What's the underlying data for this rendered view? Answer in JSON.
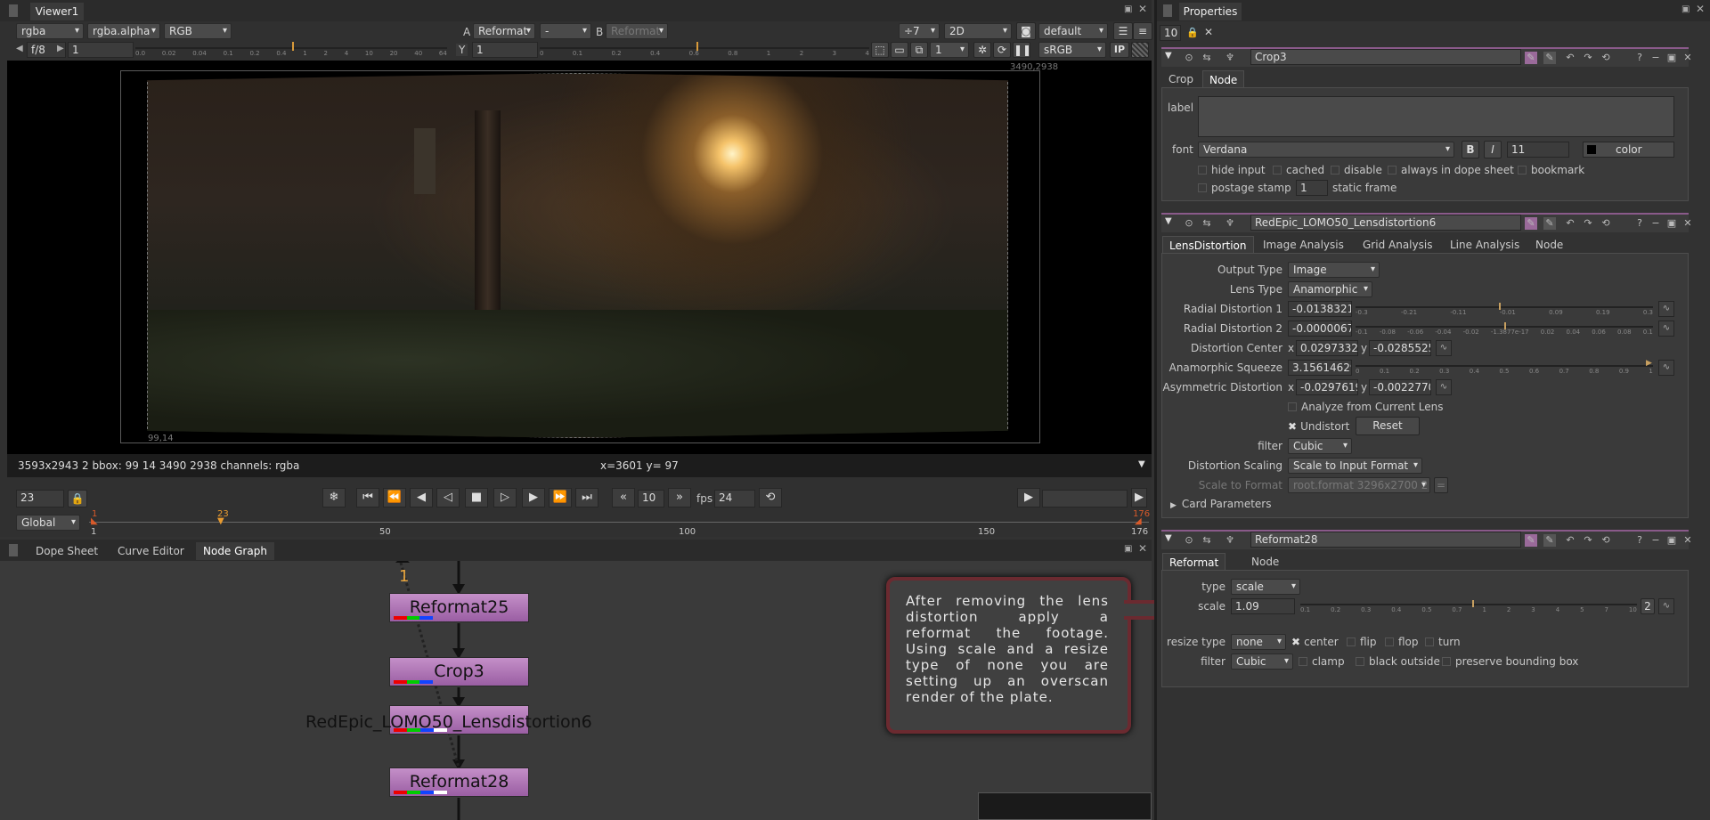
{
  "viewer": {
    "tab": "Viewer1",
    "channels": "rgba",
    "alpha": "rgba.alpha",
    "colorspace": "RGB",
    "a_label": "A",
    "a_input": "Reformat",
    "a_op": "-",
    "b_label": "B",
    "b_input": "Reformat",
    "proxy": "÷7",
    "view_mode": "2D",
    "lut": "default",
    "lut2": "sRGB",
    "fstop": "f/8",
    "gain": "1",
    "y_label": "Y",
    "gamma": "1",
    "frame_sel": "1",
    "ip": "IP",
    "gain_ticks": [
      "0.0",
      "0.02",
      "0.04",
      "0.1",
      "0.2",
      "0.4",
      "1",
      "2",
      "4",
      "10",
      "20",
      "40",
      "64"
    ],
    "gamma_ticks": [
      "0",
      "0.1",
      "0.2",
      "0.4",
      "0.6",
      "0.8",
      "1",
      "2",
      "3",
      "4"
    ],
    "corner_tr": "3490,2938",
    "corner_bl": "99,14",
    "info": "3593x2943 2 bbox: 99 14 3490 2938 channels: rgba",
    "cursor": "x=3601 y=  97"
  },
  "timeline": {
    "frame": "23",
    "fps_label": "fps",
    "fps": "24",
    "step": "10",
    "range": "Global",
    "start": "1",
    "end": "176",
    "current": "23",
    "labels": [
      "1",
      "50",
      "100",
      "150",
      "176"
    ]
  },
  "graph": {
    "tabs": [
      "Dope Sheet",
      "Curve Editor",
      "Node Graph"
    ],
    "marker": "1",
    "nodes": [
      "Reformat25",
      "Crop3",
      "RedEpic_LOMO50_Lensdistortion6",
      "Reformat28"
    ],
    "note": "After removing the lens distortion apply a reformat the footage. Using scale and a resize type of none you are setting up an overscan render of the plate."
  },
  "properties": {
    "title": "Properties",
    "max_panels": "10",
    "crop": {
      "name": "Crop3",
      "tabs": [
        "Crop",
        "Node"
      ],
      "label_lbl": "label",
      "font_lbl": "font",
      "font": "Verdana",
      "bold": "B",
      "italic": "I",
      "size": "11",
      "color_lbl": "color",
      "checks": [
        "hide input",
        "cached",
        "disable",
        "always in dope sheet",
        "bookmark"
      ],
      "postage": "postage stamp",
      "postage_val": "1",
      "static": "static frame"
    },
    "lens": {
      "name": "RedEpic_LOMO50_Lensdistortion6",
      "tabs": [
        "LensDistortion",
        "Image Analysis",
        "Grid Analysis",
        "Line Analysis",
        "Node"
      ],
      "output_type_lbl": "Output Type",
      "output_type": "Image",
      "lens_type_lbl": "Lens Type",
      "lens_type": "Anamorphic",
      "rd1_lbl": "Radial Distortion 1",
      "rd1": "-0.0138321",
      "rd2_lbl": "Radial Distortion 2",
      "rd2": "-0.00000673",
      "dc_lbl": "Distortion Center",
      "dc_x": "0.02973322",
      "dc_y": "-0.0285525",
      "as_lbl": "Anamorphic Squeeze",
      "as": "3.15614629",
      "ad_lbl": "Asymmetric Distortion",
      "ad_x": "-0.02976196",
      "ad_y": "-0.00227702",
      "analyze": "Analyze from Current Lens",
      "undistort": "Undistort",
      "reset": "Reset",
      "filter_lbl": "filter",
      "filter": "Cubic",
      "scaling_lbl": "Distortion Scaling",
      "scaling": "Scale to Input Format",
      "stf_lbl": "Scale to Format",
      "stf": "root.format 3296x2700 2",
      "card": "Card Parameters",
      "rd1_ticks": [
        "-0.3",
        "-0.21",
        "-0.11",
        "-0.01",
        "0.09",
        "0.19",
        "0.3"
      ],
      "rd2_ticks": [
        "-0.1",
        "-0.08",
        "-0.06",
        "-0.04",
        "-0.02",
        "-1.3877e-17",
        "0.02",
        "0.04",
        "0.06",
        "0.08",
        "0.1"
      ],
      "as_ticks": [
        "0",
        "0.1",
        "0.2",
        "0.3",
        "0.4",
        "0.5",
        "0.6",
        "0.7",
        "0.8",
        "0.9",
        "1"
      ]
    },
    "reformat": {
      "name": "Reformat28",
      "tabs": [
        "Reformat",
        "Node"
      ],
      "type_lbl": "type",
      "type": "scale",
      "scale_lbl": "scale",
      "scale": "1.09",
      "scale_btn": "2",
      "scale_ticks": [
        "0.1",
        "0.2",
        "0.3",
        "0.4",
        "0.5",
        "0.7",
        "1",
        "2",
        "3",
        "4",
        "5",
        "7",
        "10"
      ],
      "resize_lbl": "resize type",
      "resize": "none",
      "center": "center",
      "flip": "flip",
      "flop": "flop",
      "turn": "turn",
      "filter_lbl": "filter",
      "filter": "Cubic",
      "clamp": "clamp",
      "black": "black outside",
      "pbb": "preserve bounding box"
    }
  }
}
